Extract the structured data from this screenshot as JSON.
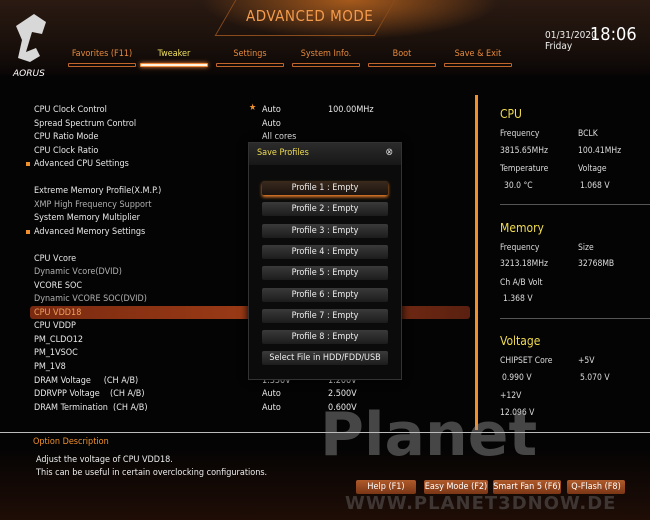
{
  "header": {
    "title": "ADVANCED MODE",
    "date": "01/31/2020",
    "day": "Friday",
    "time": "18:06",
    "logo_text": "AORUS"
  },
  "tabs": [
    {
      "label": "Favorites (F11)"
    },
    {
      "label": "Tweaker",
      "active": true
    },
    {
      "label": "Settings"
    },
    {
      "label": "System Info."
    },
    {
      "label": "Boot"
    },
    {
      "label": "Save & Exit"
    }
  ],
  "settings": [
    {
      "label": "CPU Clock Control",
      "v1": "Auto",
      "v2": "100.00MHz",
      "star": true
    },
    {
      "label": "Spread Spectrum Control",
      "v1": "Auto"
    },
    {
      "label": "CPU Ratio Mode",
      "v1": "All cores"
    },
    {
      "label": "CPU Clock Ratio"
    },
    {
      "label": "Advanced CPU Settings",
      "submenu": true
    },
    {
      "label": "Extreme Memory Profile(X.M.P.)"
    },
    {
      "label": "XMP High Frequency Support",
      "dim": true
    },
    {
      "label": "System Memory Multiplier"
    },
    {
      "label": "Advanced Memory Settings",
      "submenu": true
    },
    {
      "label": "CPU Vcore"
    },
    {
      "label": "Dynamic Vcore(DVID)",
      "dim": true
    },
    {
      "label": "VCORE SOC"
    },
    {
      "label": "Dynamic VCORE SOC(DVID)",
      "dim": true
    },
    {
      "label": "CPU VDD18",
      "selected": true
    },
    {
      "label": "CPU VDDP"
    },
    {
      "label": "PM_CLDO12"
    },
    {
      "label": "PM_1VSOC"
    },
    {
      "label": "PM_1V8"
    },
    {
      "label": "DRAM Voltage     (CH A/B)",
      "v1": "1.350V",
      "v2": "1.200V"
    },
    {
      "label": "DDRVPP Voltage    (CH A/B)",
      "v1": "Auto",
      "v2": "2.500V"
    },
    {
      "label": "DRAM Termination  (CH A/B)",
      "v1": "Auto",
      "v2": "0.600V"
    }
  ],
  "popup": {
    "title": "Save Profiles",
    "close_icon": "close-circle-icon",
    "items": [
      "Profile 1 : Empty",
      "Profile 2 : Empty",
      "Profile 3 : Empty",
      "Profile 4 : Empty",
      "Profile 5 : Empty",
      "Profile 6 : Empty",
      "Profile 7 : Empty",
      "Profile 8 : Empty",
      "Select File in HDD/FDD/USB"
    ]
  },
  "info": {
    "cpu": {
      "title": "CPU",
      "freq_label": "Frequency",
      "freq": "3815.65MHz",
      "bclk_label": "BCLK",
      "bclk": "100.41MHz",
      "temp_label": "Temperature",
      "temp": "30.0 °C",
      "volt_label": "Voltage",
      "volt": "1.068 V"
    },
    "memory": {
      "title": "Memory",
      "freq_label": "Frequency",
      "freq": "3213.18MHz",
      "size_label": "Size",
      "size": "32768MB",
      "volt_label": "Ch A/B Volt",
      "volt": "1.368 V"
    },
    "voltage": {
      "title": "Voltage",
      "chipset_label": "CHIPSET Core",
      "chipset": "0.990 V",
      "p5_label": "+5V",
      "p5": "5.070 V",
      "p12_label": "+12V",
      "p12": "12.096 V"
    }
  },
  "description": {
    "title": "Option Description",
    "line1": "Adjust the voltage of CPU VDD18.",
    "line2": "This can be useful in certain overclocking configurations."
  },
  "footer": {
    "help": "Help (F1)",
    "easy": "Easy Mode (F2)",
    "fan": "Smart Fan 5 (F6)",
    "qflash": "Q-Flash (F8)"
  },
  "watermark": {
    "text": "Planet",
    "url": "WWW.PLANET3DNOW.DE"
  },
  "colors": {
    "accent": "#f0902c",
    "highlight": "#f0dc50",
    "selected_row": "#8a3214"
  }
}
